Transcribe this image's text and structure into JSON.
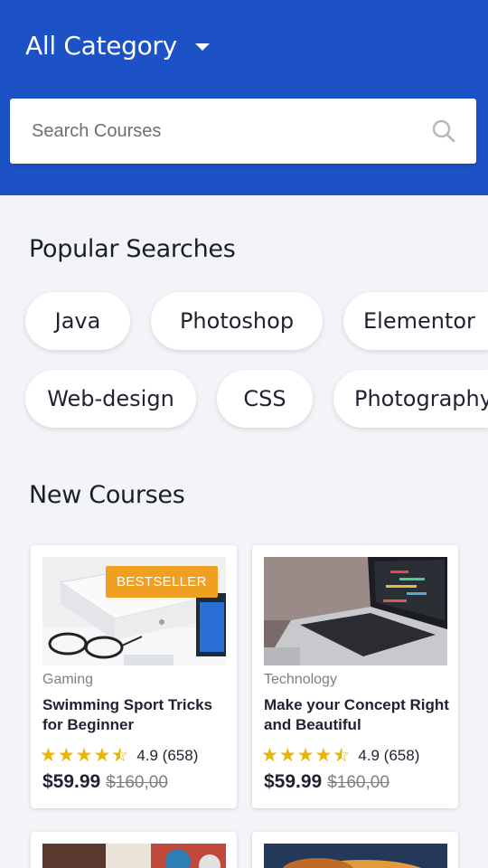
{
  "header": {
    "category_label": "All Category",
    "search_placeholder": "Search Courses",
    "colors": {
      "header_bg": "#1d52c6"
    }
  },
  "popular": {
    "title": "Popular Searches",
    "chips": [
      "Java",
      "Photoshop",
      "Elementor",
      "Web-design",
      "CSS",
      "Photography"
    ]
  },
  "new_courses": {
    "title": "New Courses",
    "courses": [
      {
        "badge": "BESTSELLER",
        "category": "Gaming",
        "title": "Swimming Sport Tricks for Beginner",
        "rating_value": 4.5,
        "rating_text": "4.9 (658)",
        "price": "$59.99",
        "old_price": "$160,00"
      },
      {
        "badge": "",
        "category": "Technology",
        "title": "Make your Concept Right and Beautiful",
        "rating_value": 4.5,
        "rating_text": "4.9 (658)",
        "price": "$59.99",
        "old_price": "$160,00"
      }
    ]
  },
  "colors": {
    "badge": "#f0a021",
    "star": "#e8b500"
  }
}
